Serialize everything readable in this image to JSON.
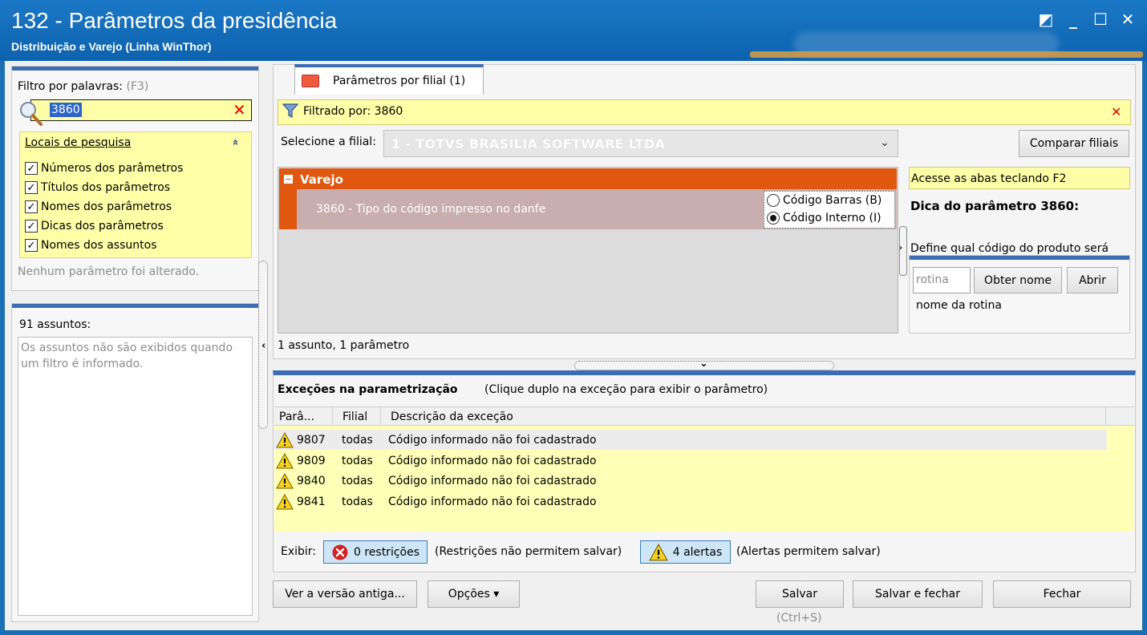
{
  "window": {
    "title": "132 - Parâmetros da presidência",
    "subtitle": "Distribuição e Varejo (Linha WinThor)",
    "controls": {
      "restore": "◩",
      "minimize": "_",
      "maximize": "☐",
      "close": "✕"
    }
  },
  "filter": {
    "label": "Filtro por palavras:",
    "hint": "(F3)",
    "value": "3860",
    "clear": "✕",
    "locations_title": "Locais de pesquisa",
    "locations_collapse": "»",
    "locations": [
      {
        "label": "Números dos parâmetros",
        "checked": true
      },
      {
        "label": "Títulos dos parâmetros",
        "checked": true
      },
      {
        "label": "Nomes dos parâmetros",
        "checked": true
      },
      {
        "label": "Dicas dos parâmetros",
        "checked": true
      },
      {
        "label": "Nomes dos assuntos",
        "checked": true
      }
    ],
    "no_change_msg": "Nenhum parâmetro foi alterado."
  },
  "subjects": {
    "label": "91 assuntos:",
    "message": "Os assuntos não são exibidos quando um filtro é informado."
  },
  "splitters": {
    "left_arrow": "‹",
    "down_arrow": "⌄",
    "side_arrow": "›"
  },
  "tab": {
    "label": "Parâmetros por filial  (1)"
  },
  "filtered": {
    "label": "Filtrado por: 3860",
    "clear": "✕"
  },
  "branch": {
    "label": "Selecione a filial:",
    "value": "1 - TOTVS BRASILIA SOFTWARE LTDA",
    "arrow": "⌄",
    "compare_label": "Comparar filiais"
  },
  "params": {
    "group": "Varejo",
    "rows": [
      {
        "name": "3860 - Tipo do código impresso no danfe",
        "options": [
          {
            "label": "Código Barras (B)",
            "selected": false
          },
          {
            "label": "Código Interno (I)",
            "selected": true
          }
        ]
      }
    ],
    "count": "1 assunto, 1 parâmetro"
  },
  "tip": {
    "bar": "Acesse as abas teclando F2",
    "title": "Dica do parâmetro 3860:",
    "body": "Define qual código do produto será"
  },
  "routine": {
    "placeholder": "rotina",
    "get_name_label": "Obter nome",
    "open_label": "Abrir",
    "name_label": "nome da rotina"
  },
  "exceptions": {
    "title": "Exceções na parametrização",
    "hint": "(Clique duplo na exceção para exibir o parâmetro)",
    "columns": [
      "Parâ...",
      "Filial",
      "Descrição da exceção"
    ],
    "rows": [
      {
        "param": "9807",
        "branch": "todas",
        "desc": "Código informado não foi cadastrado"
      },
      {
        "param": "9809",
        "branch": "todas",
        "desc": "Código informado não foi cadastrado"
      },
      {
        "param": "9840",
        "branch": "todas",
        "desc": "Código informado não foi cadastrado"
      },
      {
        "param": "9841",
        "branch": "todas",
        "desc": "Código informado não foi cadastrado"
      }
    ],
    "show_label": "Exibir:",
    "restrictions_label": "0 restrições",
    "restrictions_note": "(Restrições não permitem salvar)",
    "alerts_label": "4 alertas",
    "alerts_note": "(Alertas permitem salvar)"
  },
  "footer": {
    "old_version": "Ver a versão antiga...",
    "options": "Opções ▾",
    "save": "Salvar",
    "save_shortcut": "(Ctrl+S)",
    "save_close": "Salvar e fechar",
    "close": "Fechar"
  },
  "colors": {
    "titlebar": "#0d62ad",
    "accent": "#3b6db4",
    "group_header": "#e0570f",
    "highlight_yellow": "#ffffa8",
    "error_red": "#e00000"
  }
}
